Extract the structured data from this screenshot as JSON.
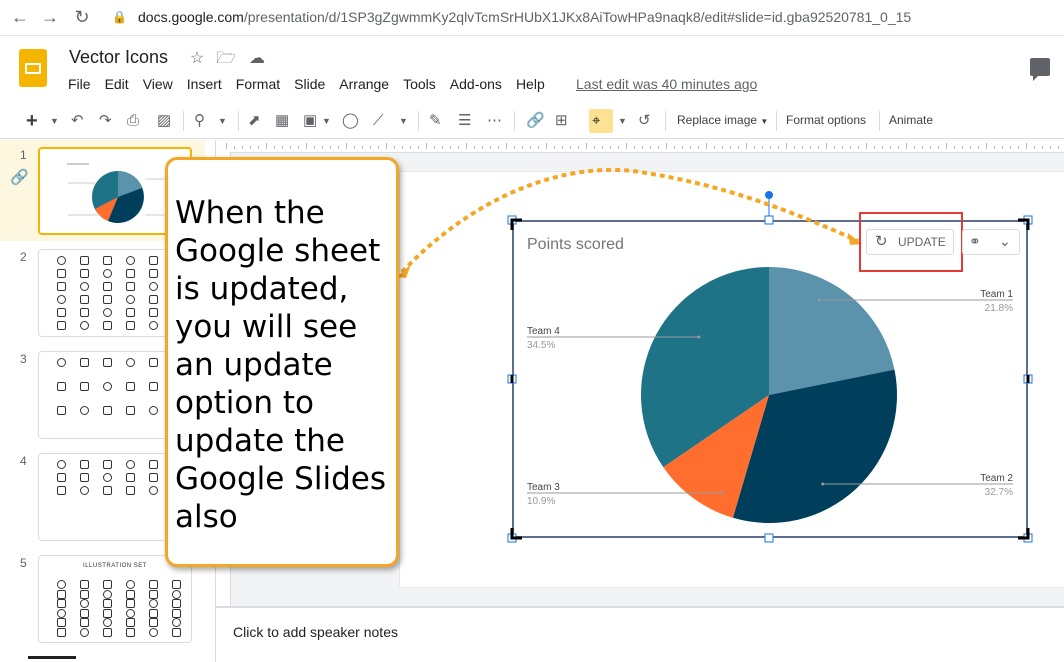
{
  "browser": {
    "url_domain": "docs.google.com",
    "url_path": "/presentation/d/1SP3gZgwmmKy2qlvTcmSrHUbX1JKx8AiTowHPa9naqk8/edit#slide=id.gba92520781_0_15"
  },
  "app": {
    "doc_title": "Vector Icons",
    "last_edit": "Last edit was 40 minutes ago",
    "menu": [
      "File",
      "Edit",
      "View",
      "Insert",
      "Format",
      "Slide",
      "Arrange",
      "Tools",
      "Add-ons",
      "Help"
    ]
  },
  "toolbar": {
    "replace_image": "Replace image",
    "format_options": "Format options",
    "animate": "Animate"
  },
  "filmstrip": {
    "slides": [
      {
        "num": "1"
      },
      {
        "num": "2"
      },
      {
        "num": "3"
      },
      {
        "num": "4"
      },
      {
        "num": "5",
        "caption": "ILLUSTRATION SET"
      }
    ]
  },
  "chart_object": {
    "update_label": "UPDATE"
  },
  "chart_data": {
    "type": "pie",
    "title": "Points scored",
    "categories": [
      "Team 1",
      "Team 2",
      "Team 3",
      "Team 4"
    ],
    "values": [
      21.8,
      32.7,
      10.9,
      34.5
    ],
    "labels": [
      "21.8%",
      "32.7%",
      "10.9%",
      "34.5%"
    ],
    "colors": [
      "#5b93ad",
      "#003f5c",
      "#ff6e2f",
      "#1f7386"
    ]
  },
  "callout": {
    "text": "When the Google sheet is updated, you will see an update option to update the Google Slides also",
    "border_color": "#f5a623"
  },
  "notes": {
    "placeholder": "Click to add speaker notes"
  }
}
